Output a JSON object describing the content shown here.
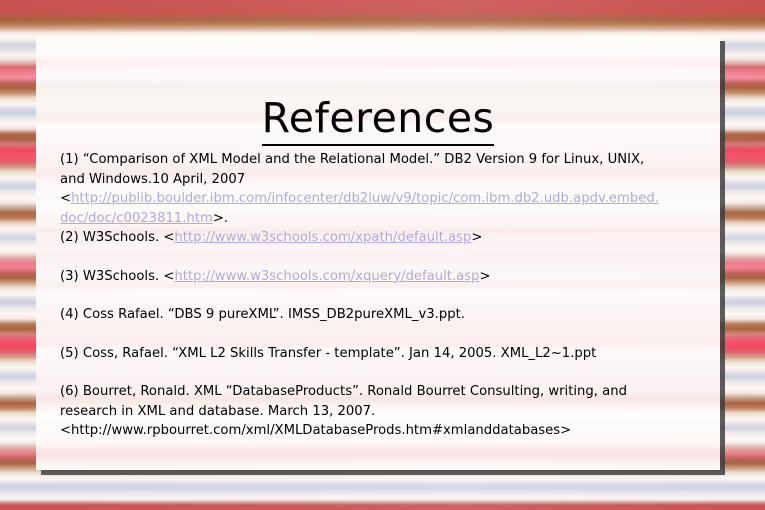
{
  "slide": {
    "title": "References",
    "theme": {
      "link_color": "#b2a9d9",
      "text_color": "#000000",
      "panel_color": "#ffffff",
      "accent_red": "#c8524f",
      "accent_pink": "#f2485f",
      "accent_brown": "#a9633f"
    }
  },
  "references": [
    {
      "number": "(1)",
      "lines": [
        "(1) “Comparison of XML Model and the Relational Model.”  DB2 Version 9 for Linux, UNIX,",
        "and Windows.10 April,  2007"
      ],
      "url_open": "<",
      "url_part1": "http://publib.boulder.ibm.com/infocenter/db2luw/v9/topic/com.ibm.db2.udb.apdv.embed.",
      "url_part2": "doc/doc/c0023811.htm",
      "url_close": ">."
    },
    {
      "number": "(2)",
      "prefix": "(2) W3Schools. <",
      "url": "http://www.w3schools.com/xpath/default.asp",
      "suffix": ">"
    },
    {
      "number": "(3)",
      "prefix": "(3) W3Schools. <",
      "url": "http://www.w3schools.com/xquery/default.asp",
      "suffix": ">"
    },
    {
      "number": "(4)",
      "text": "(4) Coss Rafael. “DBS 9 pureXML”. IMSS_DB2pureXML_v3.ppt."
    },
    {
      "number": "(5)",
      "text": "(5) Coss, Rafael. “XML L2 Skills Transfer - template”. Jan 14, 2005. XML_L2~1.ppt"
    },
    {
      "number": "(6)",
      "lines": [
        "(6) Bourret, Ronald. XML “DatabaseProducts”. Ronald Bourret Consulting, writing, and",
        "research in XML and database.  March 13, 2007.",
        "<http://www.rpbourret.com/xml/XMLDatabaseProds.htm#xmlanddatabases>"
      ]
    }
  ]
}
